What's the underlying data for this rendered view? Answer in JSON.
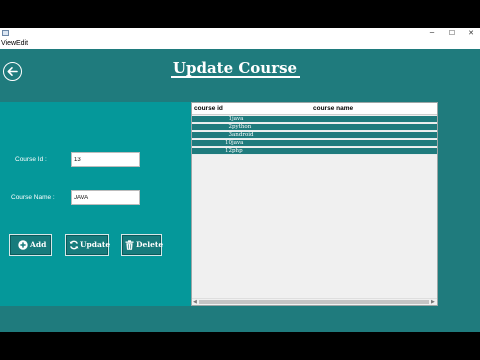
{
  "window": {
    "controls": {
      "minimize": "─",
      "maximize": "☐",
      "close": "✕"
    }
  },
  "menu": {
    "items": [
      "View",
      "Edit"
    ]
  },
  "header": {
    "title": "Update Course",
    "back_icon": "arrow-left-circle-icon"
  },
  "form": {
    "course_id": {
      "label": "Course Id :",
      "value": "13"
    },
    "course_name": {
      "label": "Course Name :",
      "value": "JAVA"
    },
    "buttons": {
      "add": {
        "label": "Add",
        "icon": "plus-circle-icon"
      },
      "update": {
        "label": "Update",
        "icon": "refresh-icon"
      },
      "delete": {
        "label": "Delete",
        "icon": "trash-icon"
      }
    }
  },
  "table": {
    "columns": [
      "course id",
      "course name"
    ],
    "rows": [
      {
        "id": "1",
        "name": "java"
      },
      {
        "id": "2",
        "name": "python"
      },
      {
        "id": "3",
        "name": "android"
      },
      {
        "id": "10",
        "name": "java"
      },
      {
        "id": "12",
        "name": "php"
      }
    ]
  },
  "colors": {
    "main_bg": "#1f7b7d",
    "panel_bg": "#05989a",
    "row_bg": "#1f7b7d"
  }
}
